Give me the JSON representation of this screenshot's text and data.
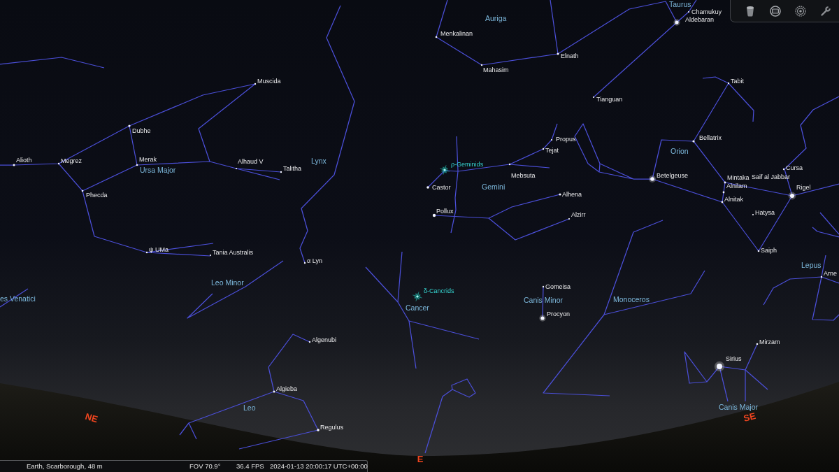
{
  "sky": {
    "constellation_labels": [
      "Taurus",
      "Auriga",
      "Orion",
      "Lynx",
      "Ursa Major",
      "Gemini",
      "Lepus",
      "Leo Minor",
      "es Venatici",
      "Canis Minor",
      "Monoceros",
      "Cancer",
      "Leo",
      "Canis Major"
    ],
    "star_labels": [
      "Chamukuy",
      "Aldebaran",
      "Menkalinan",
      "Elnath",
      "Mahasim",
      "Muscida",
      "Tabit",
      "Tianguan",
      "Dubhe",
      "Propus",
      "Bellatrix",
      "Tejat",
      "Alioth",
      "Megrez",
      "Merak",
      "Alhaud V",
      "Talitha",
      "Cursa",
      "Mebsuta",
      "Betelgeuse",
      "Mintaka",
      "Saif al Jabbar",
      "Castor",
      "Alnilam",
      "Rigel",
      "Phecda",
      "Alhena",
      "Alnitak",
      "Pollux",
      "Alzirr",
      "Hatysa",
      "ψ UMa",
      "Tania Australis",
      "Saiph",
      "α Lyn",
      "Arne",
      "Gomeisa",
      "Procyon",
      "Algenubi",
      "Mirzam",
      "Sirius",
      "Algieba",
      "Regulus"
    ],
    "meteor_showers": [
      "ρ-Geminids",
      "δ-Cancrids"
    ],
    "cardinal_points": [
      "NE",
      "SE",
      "E"
    ]
  },
  "status_bar": {
    "location": "Earth, Scarborough, 48 m",
    "fov": "FOV 70.9°",
    "fps": "36.4 FPS",
    "date_time": "2024-01-13 20:00:17 UTC+00:00"
  }
}
